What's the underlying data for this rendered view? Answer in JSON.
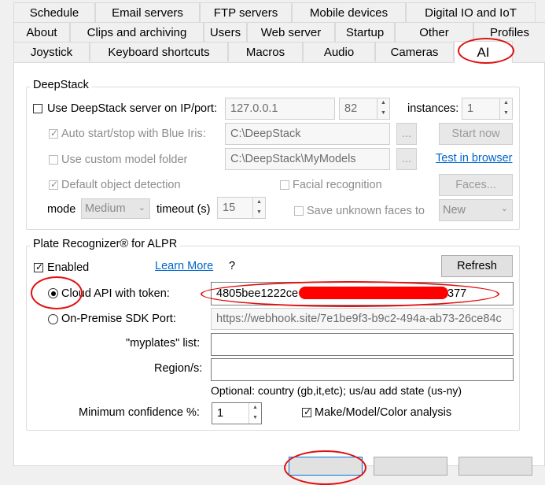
{
  "tabs_row1": [
    "Schedule",
    "Email servers",
    "FTP servers",
    "Mobile devices",
    "Digital IO and IoT"
  ],
  "tabs_row2": [
    "About",
    "Clips and archiving",
    "Users",
    "Web server",
    "Startup",
    "Other",
    "Profiles"
  ],
  "tabs_row3": [
    "Joystick",
    "Keyboard shortcuts",
    "Macros",
    "Audio",
    "Cameras",
    "AI"
  ],
  "deepstack": {
    "legend": "DeepStack",
    "use_server_label": "Use DeepStack server on IP/port:",
    "ip_value": "127.0.0.1",
    "port_value": "82",
    "instances_label": "instances:",
    "instances_value": "1",
    "auto_start_label": "Auto start/stop with Blue Iris:",
    "auto_start_path": "C:\\DeepStack",
    "browse1": "...",
    "start_now": "Start now",
    "custom_model_label": "Use custom model folder",
    "custom_model_path": "C:\\DeepStack\\MyModels",
    "browse2": "...",
    "test_browser": "Test in browser",
    "default_detection_label": "Default object detection",
    "facial_label": "Facial recognition",
    "faces_button": "Faces...",
    "mode_label": "mode",
    "mode_value": "Medium",
    "timeout_label": "timeout (s)",
    "timeout_value": "15",
    "save_unknown_label": "Save unknown faces to",
    "save_unknown_value": "New"
  },
  "plate": {
    "legend": "Plate Recognizer® for ALPR",
    "enabled_label": "Enabled",
    "learn_more": "Learn More",
    "question": "?",
    "refresh": "Refresh",
    "cloud_label": "Cloud API with token:",
    "token_start": "4805bee1222ce",
    "token_end": "377",
    "onprem_label": "On-Premise SDK Port:",
    "onprem_value": "https://webhook.site/7e1be9f3-b9c2-494a-ab73-26ce84c",
    "myplates_label": "\"myplates\" list:",
    "myplates_value": "",
    "region_label": "Region/s:",
    "region_value": "",
    "optional_text": "Optional: country (gb,it,etc); us/au add state (us-ny)",
    "min_conf_label": "Minimum confidence %:",
    "min_conf_value": "1",
    "make_model_label": "Make/Model/Color analysis"
  },
  "icons": {
    "check": "check-icon",
    "spin_up": "spin-up-icon",
    "spin_down": "spin-down-icon",
    "dropdown": "chevron-down-icon"
  },
  "colors": {
    "annotation": "#e01010",
    "redaction": "#ff0000",
    "link": "#0066cc"
  }
}
